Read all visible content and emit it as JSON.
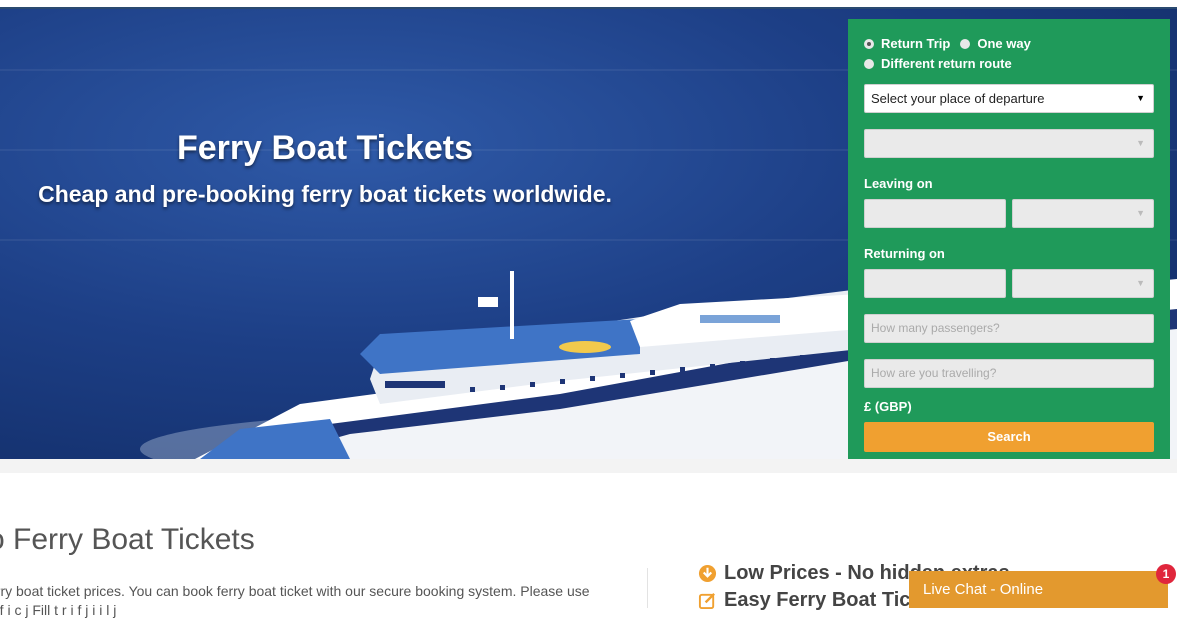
{
  "hero": {
    "title": "Ferry Boat Tickets",
    "subtitle": "Cheap and pre-booking ferry boat tickets worldwide."
  },
  "booking": {
    "trip_types": [
      {
        "label": "Return Trip",
        "selected": true
      },
      {
        "label": "One way",
        "selected": false
      },
      {
        "label": "Different return route",
        "selected": false
      }
    ],
    "departure_select": "Select your place of departure",
    "destination_select": "",
    "leaving_label": "Leaving on",
    "returning_label": "Returning on",
    "passengers_placeholder": "How many passengers?",
    "travel_placeholder": "How are you travelling?",
    "currency": "£ (GBP)",
    "search_label": "Search",
    "panel_color": "#1f9a5a",
    "button_color": "#f0a030"
  },
  "content": {
    "heading": "o Ferry Boat Tickets",
    "line1": "erry boat ticket prices. You can book ferry boat ticket with our secure booking system. Please use",
    "line2": "a  f                    i        c       j       Fill    t    r       i    f          j       i       i        l   j"
  },
  "features": [
    {
      "icon": "download-circle-icon",
      "label": "Low Prices - No hidden extras"
    },
    {
      "icon": "edit-icon",
      "label": "Easy Ferry Boat Tickets"
    }
  ],
  "chat": {
    "label": "Live Chat - Online",
    "badge_count": "1",
    "color": "#e3992e"
  }
}
